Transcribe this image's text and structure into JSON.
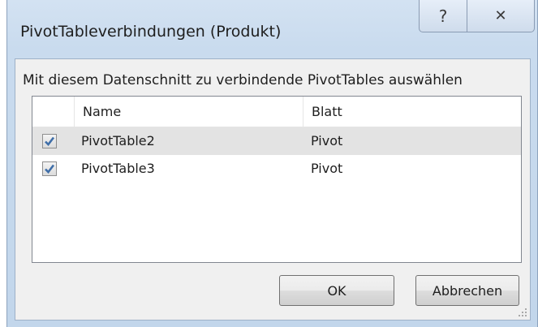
{
  "dialog": {
    "title": "PivotTableverbindungen (Produkt)",
    "help_glyph": "?",
    "close_glyph": "✕",
    "instruction": "Mit diesem Datenschnitt zu verbindende PivotTables auswählen"
  },
  "list": {
    "columns": [
      "Name",
      "Blatt"
    ],
    "rows": [
      {
        "checked": true,
        "name": "PivotTable2",
        "sheet": "Pivot"
      },
      {
        "checked": true,
        "name": "PivotTable3",
        "sheet": "Pivot"
      }
    ]
  },
  "buttons": {
    "ok_label": "OK",
    "cancel_label": "Abbrechen"
  },
  "colors": {
    "check_mark": "#3f6ea8",
    "selected_row": "#e3e3e3"
  }
}
